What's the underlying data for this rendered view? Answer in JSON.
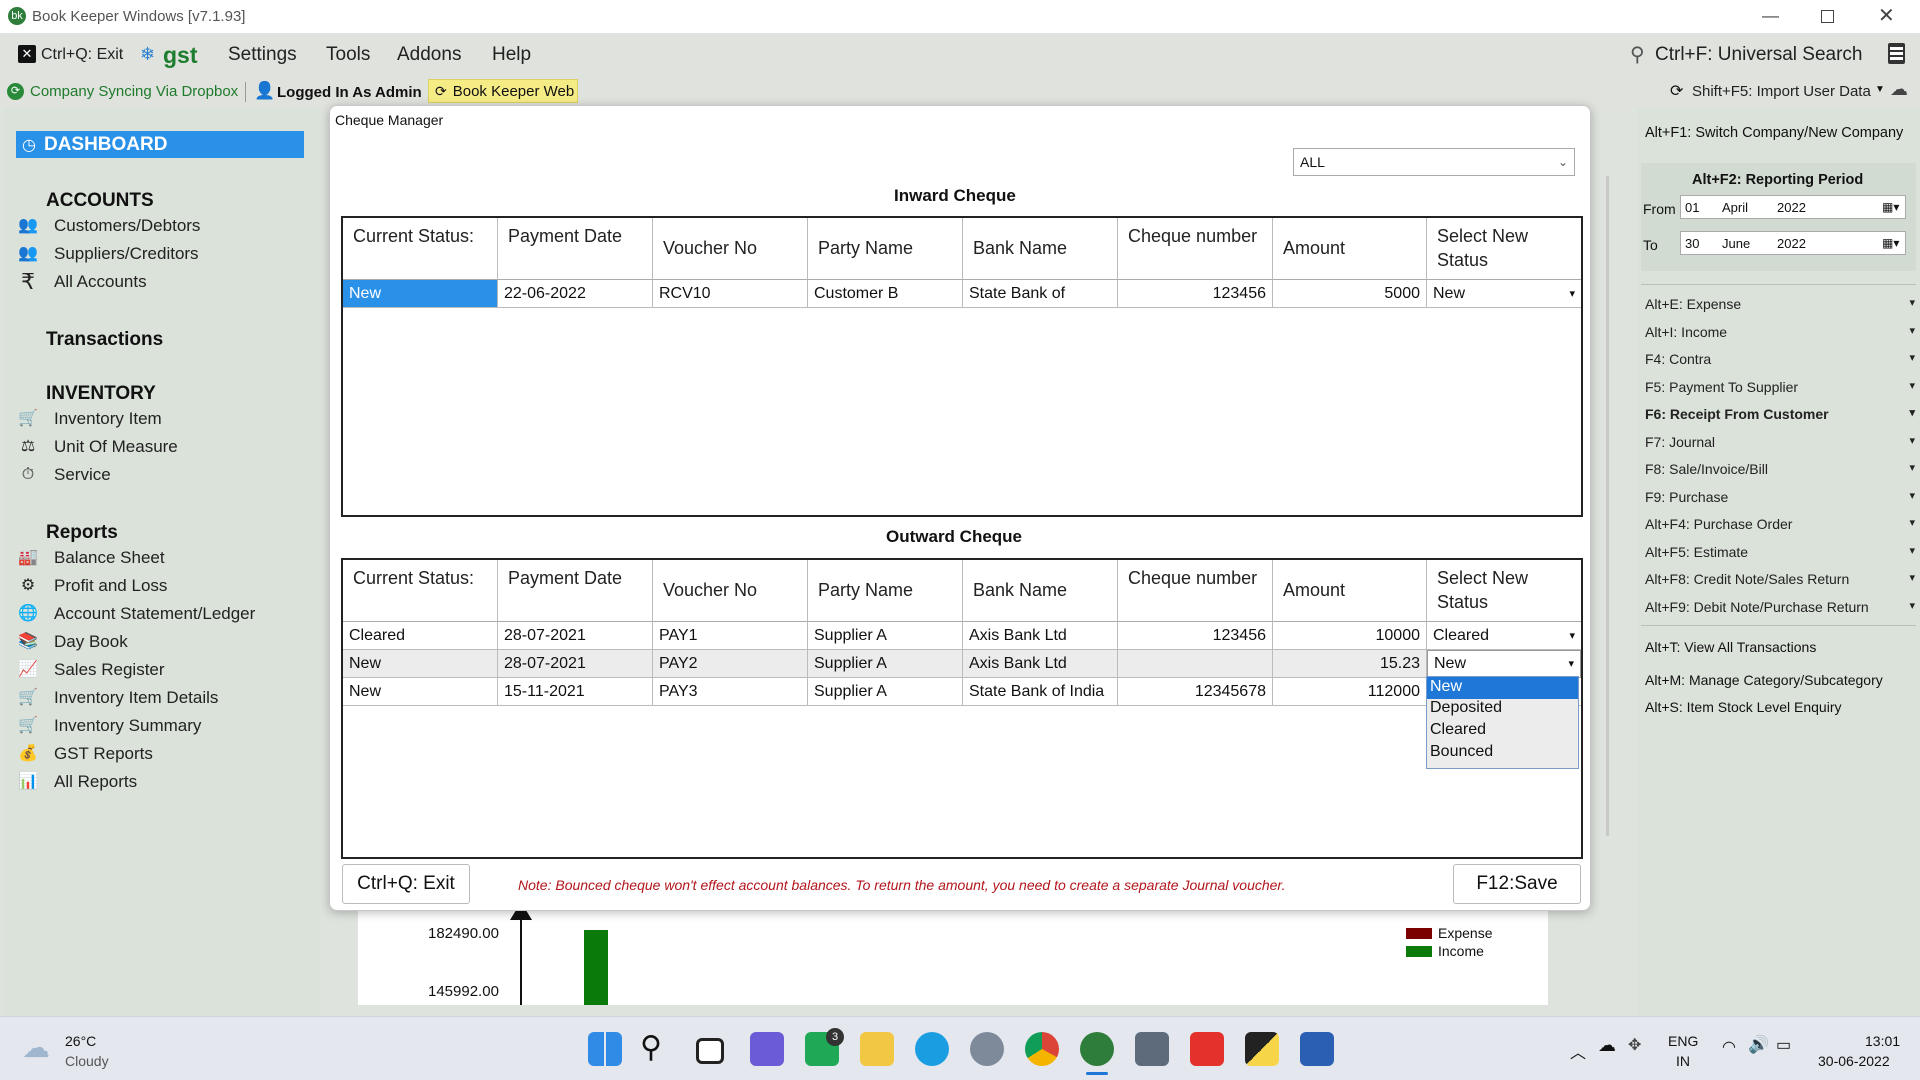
{
  "window": {
    "title": "Book Keeper Windows [v7.1.93]"
  },
  "menu": {
    "exit": "Ctrl+Q: Exit",
    "brand": "gst",
    "items": [
      "Settings",
      "Tools",
      "Addons",
      "Help"
    ],
    "search": "Ctrl+F: Universal Search"
  },
  "status": {
    "sync": "Company Syncing Via Dropbox",
    "login": "Logged In As Admin",
    "web": "Book Keeper Web",
    "import": "Shift+F5: Import User Data"
  },
  "sidebar": {
    "dashboard": "DASHBOARD",
    "accounts_title": "ACCOUNTS",
    "accounts": [
      "Customers/Debtors",
      "Suppliers/Creditors",
      "All Accounts"
    ],
    "transactions_title": "Transactions",
    "inventory_title": "INVENTORY",
    "inventory": [
      "Inventory Item",
      "Unit Of Measure",
      "Service"
    ],
    "reports_title": "Reports",
    "reports": [
      "Balance Sheet",
      "Profit and Loss",
      "Account Statement/Ledger",
      "Day Book",
      "Sales Register",
      "Inventory Item Details",
      "Inventory Summary",
      "GST Reports",
      "All Reports"
    ]
  },
  "right_panel": {
    "switch_company": "Alt+F1: Switch Company/New Company",
    "period_title": "Alt+F2: Reporting Period",
    "from_label": "From",
    "from": {
      "day": "01",
      "month": "April",
      "year": "2022"
    },
    "to_label": "To",
    "to": {
      "day": "30",
      "month": "June",
      "year": "2022"
    },
    "shortcuts": [
      "Alt+E: Expense",
      "Alt+I: Income",
      "F4: Contra",
      "F5: Payment To Supplier",
      "F6: Receipt From Customer",
      "F7: Journal",
      "F8: Sale/Invoice/Bill",
      "F9: Purchase",
      "Alt+F4: Purchase Order",
      "Alt+F5: Estimate",
      "Alt+F8: Credit Note/Sales Return",
      "Alt+F9: Debit Note/Purchase Return"
    ],
    "links": [
      "Alt+T: View All Transactions",
      "Alt+M: Manage Category/Subcategory",
      "Alt+S: Item Stock Level Enquiry"
    ]
  },
  "dialog": {
    "title": "Cheque Manager",
    "filter": "ALL",
    "inward_title": "Inward Cheque",
    "outward_title": "Outward Cheque",
    "columns": [
      "Current Status:",
      "Payment Date",
      "Voucher No",
      "Party Name",
      "Bank Name",
      "Cheque number",
      "Amount",
      "Select New Status"
    ],
    "inward_rows": [
      {
        "status": "New",
        "date": "22-06-2022",
        "voucher": "RCV10",
        "party": "Customer B",
        "bank": "State Bank of",
        "cheque": "123456",
        "amount": "5000",
        "new_status": "New"
      }
    ],
    "outward_rows": [
      {
        "status": "Cleared",
        "date": "28-07-2021",
        "voucher": "PAY1",
        "party": "Supplier A",
        "bank": "Axis Bank Ltd",
        "cheque": "123456",
        "amount": "10000",
        "new_status": "Cleared"
      },
      {
        "status": "New",
        "date": "28-07-2021",
        "voucher": "PAY2",
        "party": "Supplier A",
        "bank": "Axis Bank Ltd",
        "cheque": "",
        "amount": "15.23",
        "new_status": "New"
      },
      {
        "status": "New",
        "date": "15-11-2021",
        "voucher": "PAY3",
        "party": "Supplier A",
        "bank": "State Bank of India",
        "cheque": "12345678",
        "amount": "112000",
        "new_status": ""
      }
    ],
    "dropdown_options": [
      "New",
      "Deposited",
      "Cleared",
      "Bounced"
    ],
    "dropdown_selected": "New",
    "exit_button": "Ctrl+Q: Exit",
    "note": "Note: Bounced cheque won't effect account balances. To return the amount, you need to create a separate Journal voucher.",
    "save_button": "F12:Save"
  },
  "background_chart": {
    "y_ticks": [
      "182490.00",
      "145992.00"
    ],
    "legend": [
      "Expense",
      "Income"
    ],
    "colors": {
      "expense": "#7b0000",
      "income": "#0a7a0a"
    }
  },
  "taskbar": {
    "temp": "26°C",
    "weather": "Cloudy",
    "lang1": "ENG",
    "lang2": "IN",
    "time": "13:01",
    "date": "30-06-2022",
    "badge": "3"
  }
}
